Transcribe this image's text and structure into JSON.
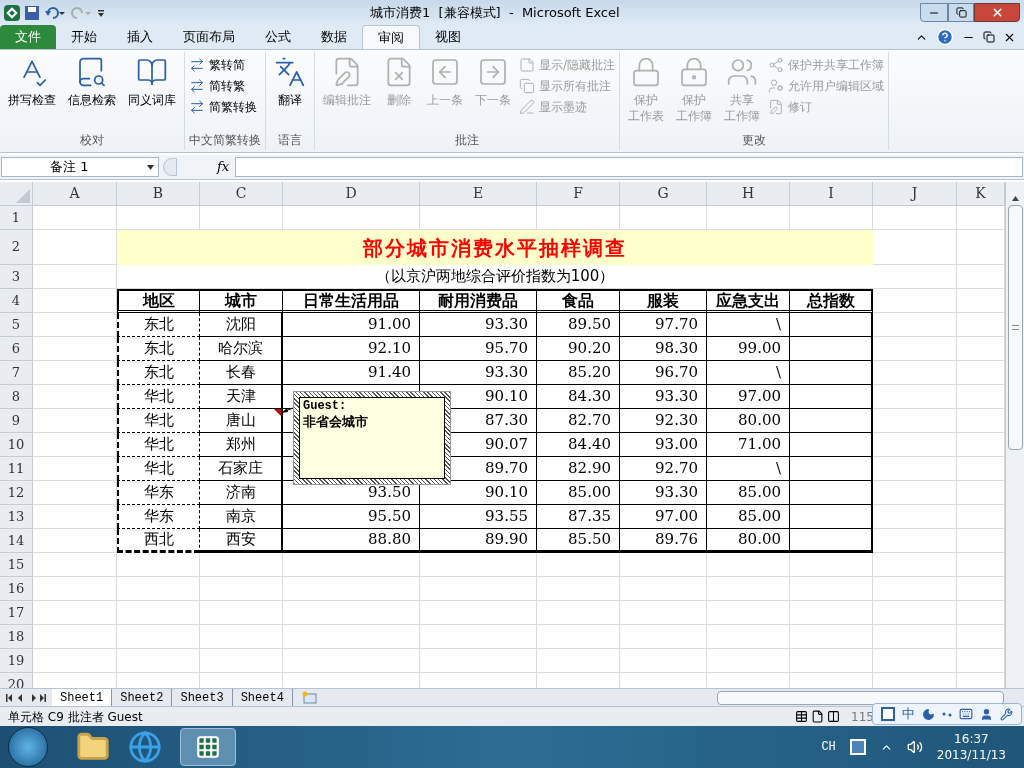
{
  "window": {
    "title": "城市消费1  [兼容模式]  -  Microsoft Excel"
  },
  "ribbon_tabs": [
    {
      "label": "文件",
      "kind": "file",
      "selected": false
    },
    {
      "label": "开始",
      "kind": "tab",
      "selected": false
    },
    {
      "label": "插入",
      "kind": "tab",
      "selected": false
    },
    {
      "label": "页面布局",
      "kind": "tab",
      "selected": false
    },
    {
      "label": "公式",
      "kind": "tab",
      "selected": false
    },
    {
      "label": "数据",
      "kind": "tab",
      "selected": false
    },
    {
      "label": "审阅",
      "kind": "tab",
      "selected": true
    },
    {
      "label": "视图",
      "kind": "tab",
      "selected": false
    }
  ],
  "ribbon_groups": [
    {
      "label": "校对",
      "buttons": [
        {
          "lines": [
            "拼写检查"
          ],
          "kind": "large",
          "disabled": false
        },
        {
          "lines": [
            "信息检索"
          ],
          "kind": "large",
          "disabled": false
        },
        {
          "lines": [
            "同义词库"
          ],
          "kind": "large",
          "disabled": false
        }
      ]
    },
    {
      "label": "中文简繁转换",
      "buttons": [
        {
          "lines": [
            "繁转简"
          ],
          "kind": "small",
          "disabled": false
        },
        {
          "lines": [
            "简转繁"
          ],
          "kind": "small",
          "disabled": false
        },
        {
          "lines": [
            "简繁转换"
          ],
          "kind": "small",
          "disabled": false
        }
      ]
    },
    {
      "label": "语言",
      "buttons": [
        {
          "lines": [
            "翻译"
          ],
          "kind": "large",
          "disabled": false
        }
      ]
    },
    {
      "label": "批注",
      "buttons": [
        {
          "lines": [
            "编辑批注"
          ],
          "kind": "large",
          "disabled": true
        },
        {
          "lines": [
            "删除"
          ],
          "kind": "large",
          "disabled": true
        },
        {
          "lines": [
            "上一条"
          ],
          "kind": "large",
          "disabled": true
        },
        {
          "lines": [
            "下一条"
          ],
          "kind": "large",
          "disabled": true
        },
        {
          "lines": [
            "显示/隐藏批注"
          ],
          "kind": "small",
          "disabled": true
        },
        {
          "lines": [
            "显示所有批注"
          ],
          "kind": "small",
          "disabled": true
        },
        {
          "lines": [
            "显示墨迹"
          ],
          "kind": "small",
          "disabled": true
        }
      ]
    },
    {
      "label": "更改",
      "buttons": [
        {
          "lines": [
            "保护",
            "工作表"
          ],
          "kind": "large",
          "disabled": true
        },
        {
          "lines": [
            "保护",
            "工作簿"
          ],
          "kind": "large",
          "disabled": true
        },
        {
          "lines": [
            "共享",
            "工作簿"
          ],
          "kind": "large",
          "disabled": true
        },
        {
          "lines": [
            "保护并共享工作簿"
          ],
          "kind": "small",
          "disabled": true
        },
        {
          "lines": [
            "允许用户编辑区域"
          ],
          "kind": "small",
          "disabled": true
        },
        {
          "lines": [
            "修订"
          ],
          "kind": "small",
          "disabled": true
        }
      ]
    }
  ],
  "formula_bar": {
    "name_box": "备注 1",
    "fx": "fx"
  },
  "columns": [
    "A",
    "B",
    "C",
    "D",
    "E",
    "F",
    "G",
    "H",
    "I",
    "J",
    "K"
  ],
  "sheet": {
    "title": "部分城市消费水平抽样调查",
    "subtitle": "（以京沪两地综合评价指数为100）",
    "headers": [
      "地区",
      "城市",
      "日常生活用品",
      "耐用消费品",
      "食品",
      "服装",
      "应急支出",
      "总指数"
    ],
    "rows": [
      {
        "region": "东北",
        "city": "沈阳",
        "daily": "91.00",
        "values": [
          "93.30",
          "89.50",
          "97.70",
          "\\"
        ]
      },
      {
        "region": "东北",
        "city": "哈尔滨",
        "daily": "92.10",
        "values": [
          "95.70",
          "90.20",
          "98.30",
          "99.00"
        ]
      },
      {
        "region": "东北",
        "city": "长春",
        "daily": "91.40",
        "values": [
          "93.30",
          "85.20",
          "96.70",
          "\\"
        ]
      },
      {
        "region": "华北",
        "city": "天津",
        "values": [
          "90.10",
          "84.30",
          "93.30",
          "97.00"
        ]
      },
      {
        "region": "华北",
        "city": "唐山",
        "values": [
          "87.30",
          "82.70",
          "92.30",
          "80.00"
        ],
        "has_comment": true
      },
      {
        "region": "华北",
        "city": "郑州",
        "values": [
          "90.07",
          "84.40",
          "93.00",
          "71.00"
        ]
      },
      {
        "region": "华北",
        "city": "石家庄",
        "values": [
          "89.70",
          "82.90",
          "92.70",
          "\\"
        ]
      },
      {
        "region": "华东",
        "city": "济南",
        "daily": "93.50",
        "values": [
          "90.10",
          "85.00",
          "93.30",
          "85.00"
        ]
      },
      {
        "region": "华东",
        "city": "南京",
        "daily": "95.50",
        "values": [
          "93.55",
          "87.35",
          "97.00",
          "85.00"
        ]
      },
      {
        "region": "西北",
        "city": "西安",
        "daily": "88.80",
        "values": [
          "89.90",
          "85.50",
          "89.76",
          "80.00"
        ]
      }
    ]
  },
  "row_numbers": [
    "1",
    "2",
    "3",
    "4",
    "5",
    "6",
    "7",
    "8",
    "9",
    "10",
    "11",
    "12",
    "13",
    "14",
    "15",
    "16",
    "17",
    "18",
    "19",
    "20"
  ],
  "comment": {
    "author": "Guest:",
    "text": "非省会城市"
  },
  "sheet_tabs": [
    {
      "label": "Sheet1",
      "selected": true
    },
    {
      "label": "Sheet2",
      "selected": false
    },
    {
      "label": "Sheet3",
      "selected": false
    },
    {
      "label": "Sheet4",
      "selected": false
    }
  ],
  "status_bar": {
    "text": "单元格 C9 批注者 Guest",
    "zoom": "115"
  },
  "ime_bar": {
    "mode": "中"
  },
  "taskbar": {
    "language": "CH",
    "time": "16:37",
    "date": "2013/11/13"
  }
}
